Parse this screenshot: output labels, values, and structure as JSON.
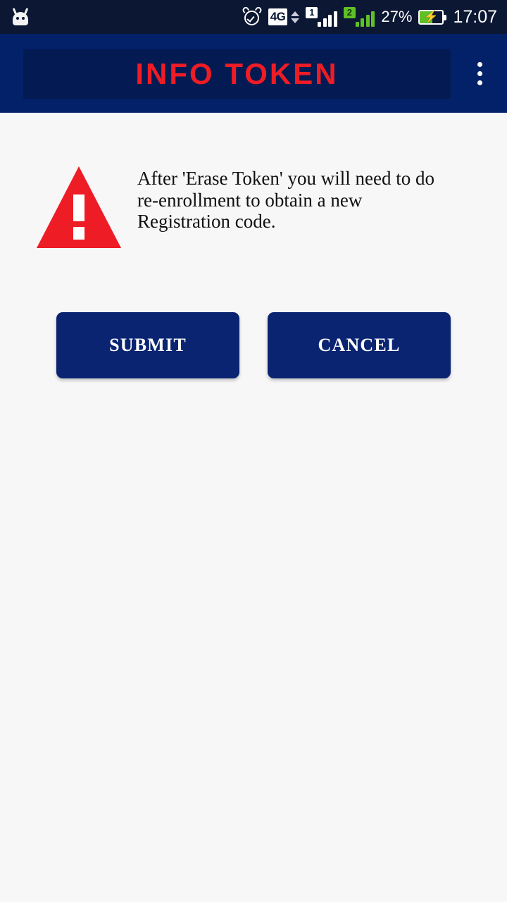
{
  "status_bar": {
    "left_icon": "cyanogenmod-robot-icon",
    "alarm_icon": "alarm-clock-icon",
    "network_type": "4G",
    "data_arrows_icon": "data-transfer-arrows-icon",
    "sim1_label": "1",
    "sim2_label": "2",
    "battery_percent": "27%",
    "battery_icon": "charging-battery-icon",
    "charging_bolt": "⚡",
    "time": "17:07"
  },
  "app_bar": {
    "title": "INFO TOKEN",
    "title_color": "#ee1c25",
    "bar_color": "#032169",
    "panel_color": "#041a52",
    "overflow_icon": "overflow-menu-icon"
  },
  "content": {
    "warning_icon": "warning-triangle-icon",
    "warning_color": "#ee1c25",
    "message": "After 'Erase Token' you will need to do re-enrollment to obtain a new Registration code.",
    "buttons": [
      {
        "label": "SUBMIT",
        "name": "submit-button"
      },
      {
        "label": "CANCEL",
        "name": "cancel-button"
      }
    ],
    "button_color": "#0a2472",
    "background_color": "#f7f7f7"
  }
}
